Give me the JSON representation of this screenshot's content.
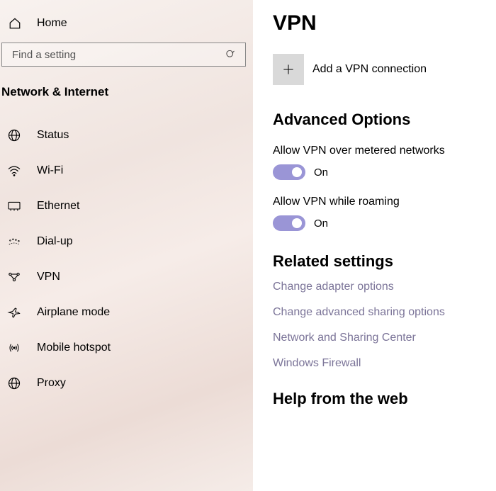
{
  "sidebar": {
    "home": "Home",
    "searchPlaceholder": "Find a setting",
    "sectionTitle": "Network & Internet",
    "items": [
      {
        "label": "Status",
        "icon": "status"
      },
      {
        "label": "Wi-Fi",
        "icon": "wifi"
      },
      {
        "label": "Ethernet",
        "icon": "ethernet"
      },
      {
        "label": "Dial-up",
        "icon": "dialup"
      },
      {
        "label": "VPN",
        "icon": "vpn"
      },
      {
        "label": "Airplane mode",
        "icon": "airplane"
      },
      {
        "label": "Mobile hotspot",
        "icon": "hotspot"
      },
      {
        "label": "Proxy",
        "icon": "proxy"
      }
    ]
  },
  "page": {
    "title": "VPN",
    "addLabel": "Add a VPN connection",
    "advancedTitle": "Advanced Options",
    "options": [
      {
        "label": "Allow VPN over metered networks",
        "stateLabel": "On",
        "on": true
      },
      {
        "label": "Allow VPN while roaming",
        "stateLabel": "On",
        "on": true
      }
    ],
    "relatedTitle": "Related settings",
    "relatedLinks": [
      "Change adapter options",
      "Change advanced sharing options",
      "Network and Sharing Center",
      "Windows Firewall"
    ],
    "helpTitle": "Help from the web"
  },
  "colors": {
    "toggleOn": "#9a95d6",
    "link": "#7b7498"
  }
}
